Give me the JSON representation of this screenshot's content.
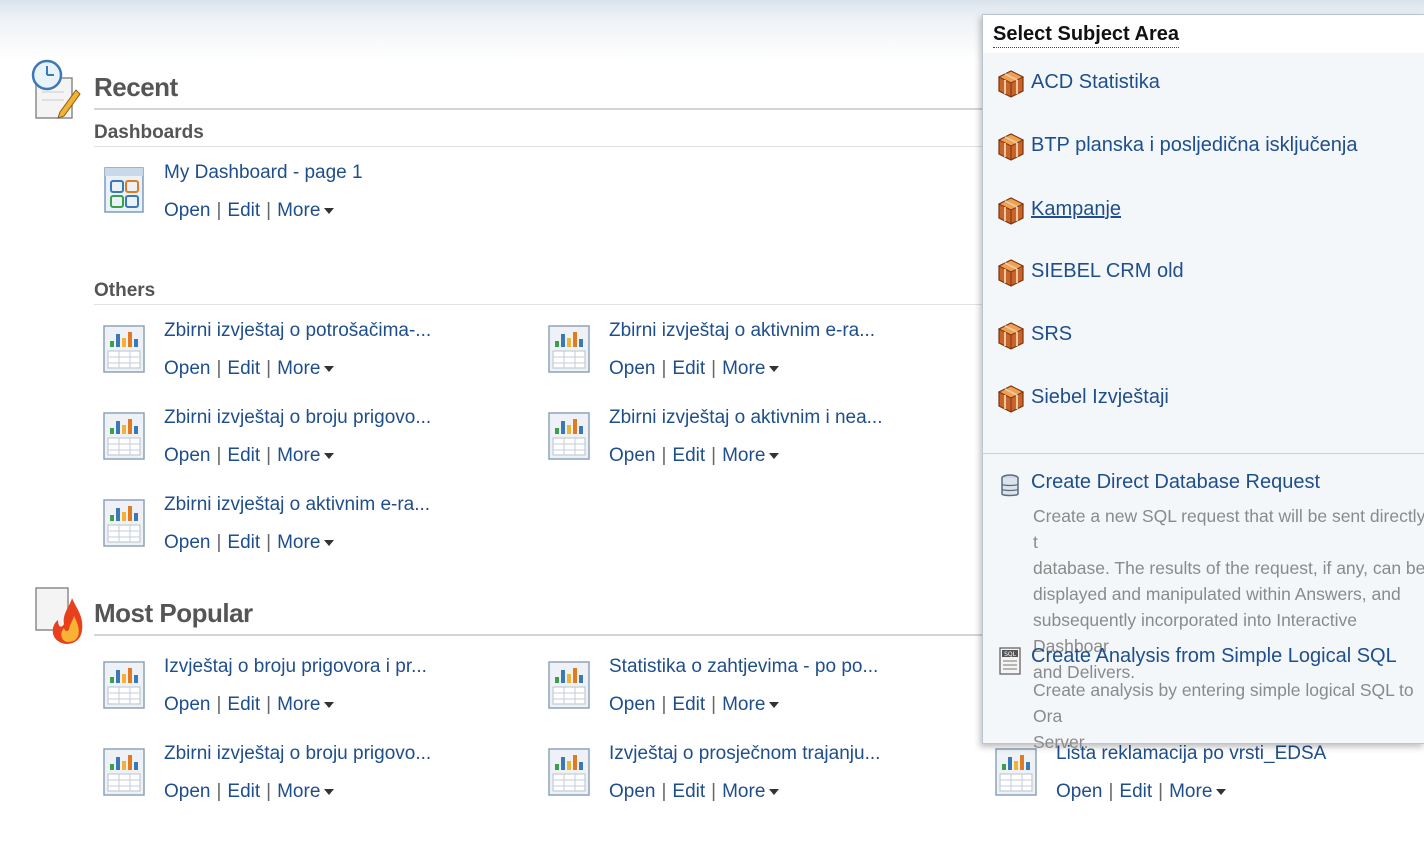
{
  "recent": {
    "title": "Recent",
    "dashboards_heading": "Dashboards",
    "dashboard_item": {
      "name": "My Dashboard - page 1"
    },
    "others_heading": "Others",
    "others": [
      {
        "name": "Zbirni izvještaj o potrošačima-..."
      },
      {
        "name": "Zbirni izvještaj o aktivnim e-ra..."
      },
      {
        "name": "Zbirni izvještaj o broju prigovo..."
      },
      {
        "name": "Zbirni izvještaj o aktivnim i nea..."
      },
      {
        "name": "Zbirni izvještaj o aktivnim e-ra..."
      }
    ]
  },
  "most_popular": {
    "title": "Most Popular",
    "items": [
      {
        "name": "Izvještaj o broju prigovora i pr..."
      },
      {
        "name": "Statistika o zahtjevima - po po..."
      },
      {
        "name": "Zbirni izvještaj o broju prigovo..."
      },
      {
        "name": "Izvještaj o prosječnom trajanju..."
      },
      {
        "name": "Lista reklamacija po vrsti_EDSA"
      }
    ]
  },
  "actions": {
    "open": "Open",
    "edit": "Edit",
    "more": "More",
    "sep": "|"
  },
  "subject_panel": {
    "title": "Select Subject Area",
    "areas": [
      {
        "label": "ACD Statistika"
      },
      {
        "label": "BTP planska i posljedična isključenja"
      },
      {
        "label": "Kampanje"
      },
      {
        "label": "SIEBEL CRM old"
      },
      {
        "label": "SRS"
      },
      {
        "label": "Siebel Izvještaji"
      }
    ],
    "direct_db": {
      "title": "Create Direct Database Request",
      "desc": "Create a new SQL request that will be sent directly t\ndatabase. The results of the request, if any, can be\ndisplayed and manipulated within Answers, and\nsubsequently incorporated into Interactive Dashboar\nand Delivers."
    },
    "logical_sql": {
      "title": "Create Analysis from Simple Logical SQL",
      "desc": "Create analysis by entering simple logical SQL to Ora\nServer."
    }
  },
  "icons": {
    "recent": "clock-pencil-icon",
    "most_popular": "flame-document-icon",
    "dashboard": "dashboard-icon",
    "report": "report-chart-icon",
    "subject_area": "cube-icon",
    "database": "database-icon",
    "sql": "sql-document-icon"
  },
  "colors": {
    "link": "#1f4e8c",
    "heading": "#555555",
    "description": "#8a8a8a"
  }
}
